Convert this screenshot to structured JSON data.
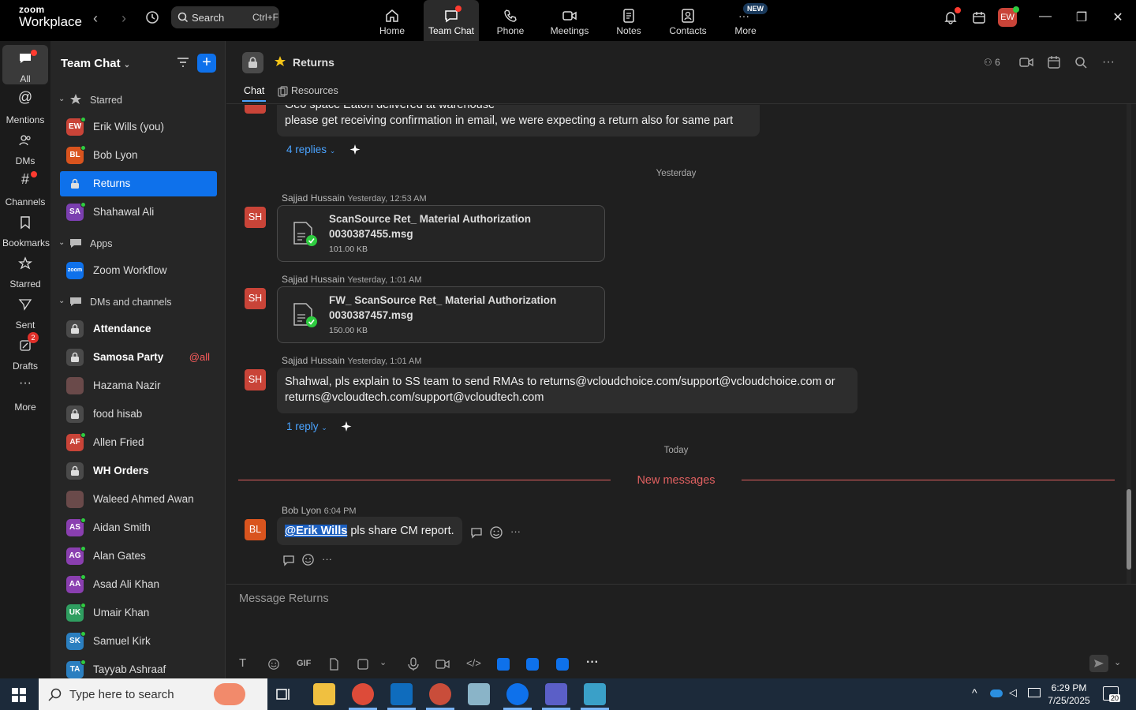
{
  "app": {
    "brand_top": "zoom",
    "brand_name": "Workplace"
  },
  "topbar": {
    "search_label": "Search",
    "search_shortcut": "Ctrl+F",
    "nav": [
      "Home",
      "Team Chat",
      "Phone",
      "Meetings",
      "Notes",
      "Contacts",
      "More"
    ],
    "more_badge": "NEW",
    "avatar": "EW"
  },
  "rail": {
    "items": [
      "All",
      "Mentions",
      "DMs",
      "Channels",
      "Bookmarks",
      "Starred",
      "Sent",
      "Drafts",
      "More"
    ],
    "drafts_badge": "2"
  },
  "sidebar": {
    "title": "Team Chat",
    "sections": {
      "starred": "Starred",
      "apps": "Apps",
      "dms": "DMs and channels"
    },
    "starred": [
      {
        "initials": "EW",
        "name": "Erik Wills (you)",
        "color": "#c94438"
      },
      {
        "initials": "BL",
        "name": "Bob Lyon",
        "color": "#d9541e"
      },
      {
        "initials": "",
        "name": "Returns",
        "color": "#0e71eb"
      },
      {
        "initials": "SA",
        "name": "Shahawal Ali",
        "color": "#7b3fb0"
      }
    ],
    "apps": [
      {
        "initials": "zoom",
        "name": "Zoom Workflow",
        "color": "#0e71eb"
      }
    ],
    "dms": [
      {
        "initials": "",
        "name": "Attendance",
        "bold": true
      },
      {
        "initials": "",
        "name": "Samosa Party",
        "bold": true,
        "mention": "@all"
      },
      {
        "initials": "",
        "name": "Hazama Nazir",
        "bold": false
      },
      {
        "initials": "",
        "name": "food hisab",
        "bold": false
      },
      {
        "initials": "AF",
        "name": "Allen Fried",
        "bold": false,
        "color": "#c94438"
      },
      {
        "initials": "",
        "name": "WH Orders",
        "bold": true
      },
      {
        "initials": "",
        "name": "Waleed Ahmed Awan",
        "bold": false
      },
      {
        "initials": "AS",
        "name": "Aidan Smith",
        "bold": false,
        "color": "#8a3fb0"
      },
      {
        "initials": "AG",
        "name": "Alan Gates",
        "bold": false,
        "color": "#8a3fb0"
      },
      {
        "initials": "AA",
        "name": "Asad Ali Khan",
        "bold": false,
        "color": "#8a3fb0"
      },
      {
        "initials": "UK",
        "name": "Umair Khan",
        "bold": false,
        "color": "#2f9e60"
      },
      {
        "initials": "SK",
        "name": "Samuel Kirk",
        "bold": false,
        "color": "#2b7fc0"
      },
      {
        "initials": "TA",
        "name": "Tayyab Ashraaf",
        "bold": false,
        "color": "#2b7fc0"
      }
    ]
  },
  "channel": {
    "name": "Returns",
    "member_count": "6",
    "tabs": [
      "Chat",
      "Resources"
    ]
  },
  "messages": {
    "partial_line1": "Geo space Eaton delivered at warehouse",
    "partial_line2": "please get receiving confirmation in email, we were expecting a return also for same part",
    "partial_replies": "4 replies",
    "day1": "Yesterday",
    "m1": {
      "sender": "Sajjad Hussain",
      "time": "Yesterday, 12:53 AM",
      "avatar": "SH",
      "file_line1": "ScanSource Ret_ Material Authorization",
      "file_line2": "0030387455.msg",
      "file_size": "101.00 KB"
    },
    "m2": {
      "sender": "Sajjad Hussain",
      "time": "Yesterday, 1:01 AM",
      "avatar": "SH",
      "file_line1": "FW_ ScanSource Ret_ Material Authorization",
      "file_line2": "0030387457.msg",
      "file_size": "150.00 KB"
    },
    "m3": {
      "sender": "Sajjad Hussain",
      "time": "Yesterday, 1:01 AM",
      "avatar": "SH",
      "line1": "Shahwal, pls explain to SS team to send RMAs to returns@vcloudchoice.com/support@vcloudchoice.com or",
      "line2": "returns@vcloudtech.com/support@vcloudtech.com",
      "replies": "1 reply"
    },
    "day2": "Today",
    "new_messages": "New messages",
    "m4": {
      "sender": "Bob Lyon",
      "time": "6:04 PM",
      "avatar": "BL",
      "mention": "@Erik Wills",
      "text": " pls share CM report."
    }
  },
  "composer": {
    "placeholder": "Message Returns",
    "gif": "GIF"
  },
  "taskbar": {
    "search_placeholder": "Type here to search",
    "time": "6:29 PM",
    "date": "7/25/2025",
    "notif_count": "20"
  },
  "colors": {
    "accent": "#0e71eb",
    "new_messages": "#e06060",
    "link": "#4aa3ff"
  }
}
